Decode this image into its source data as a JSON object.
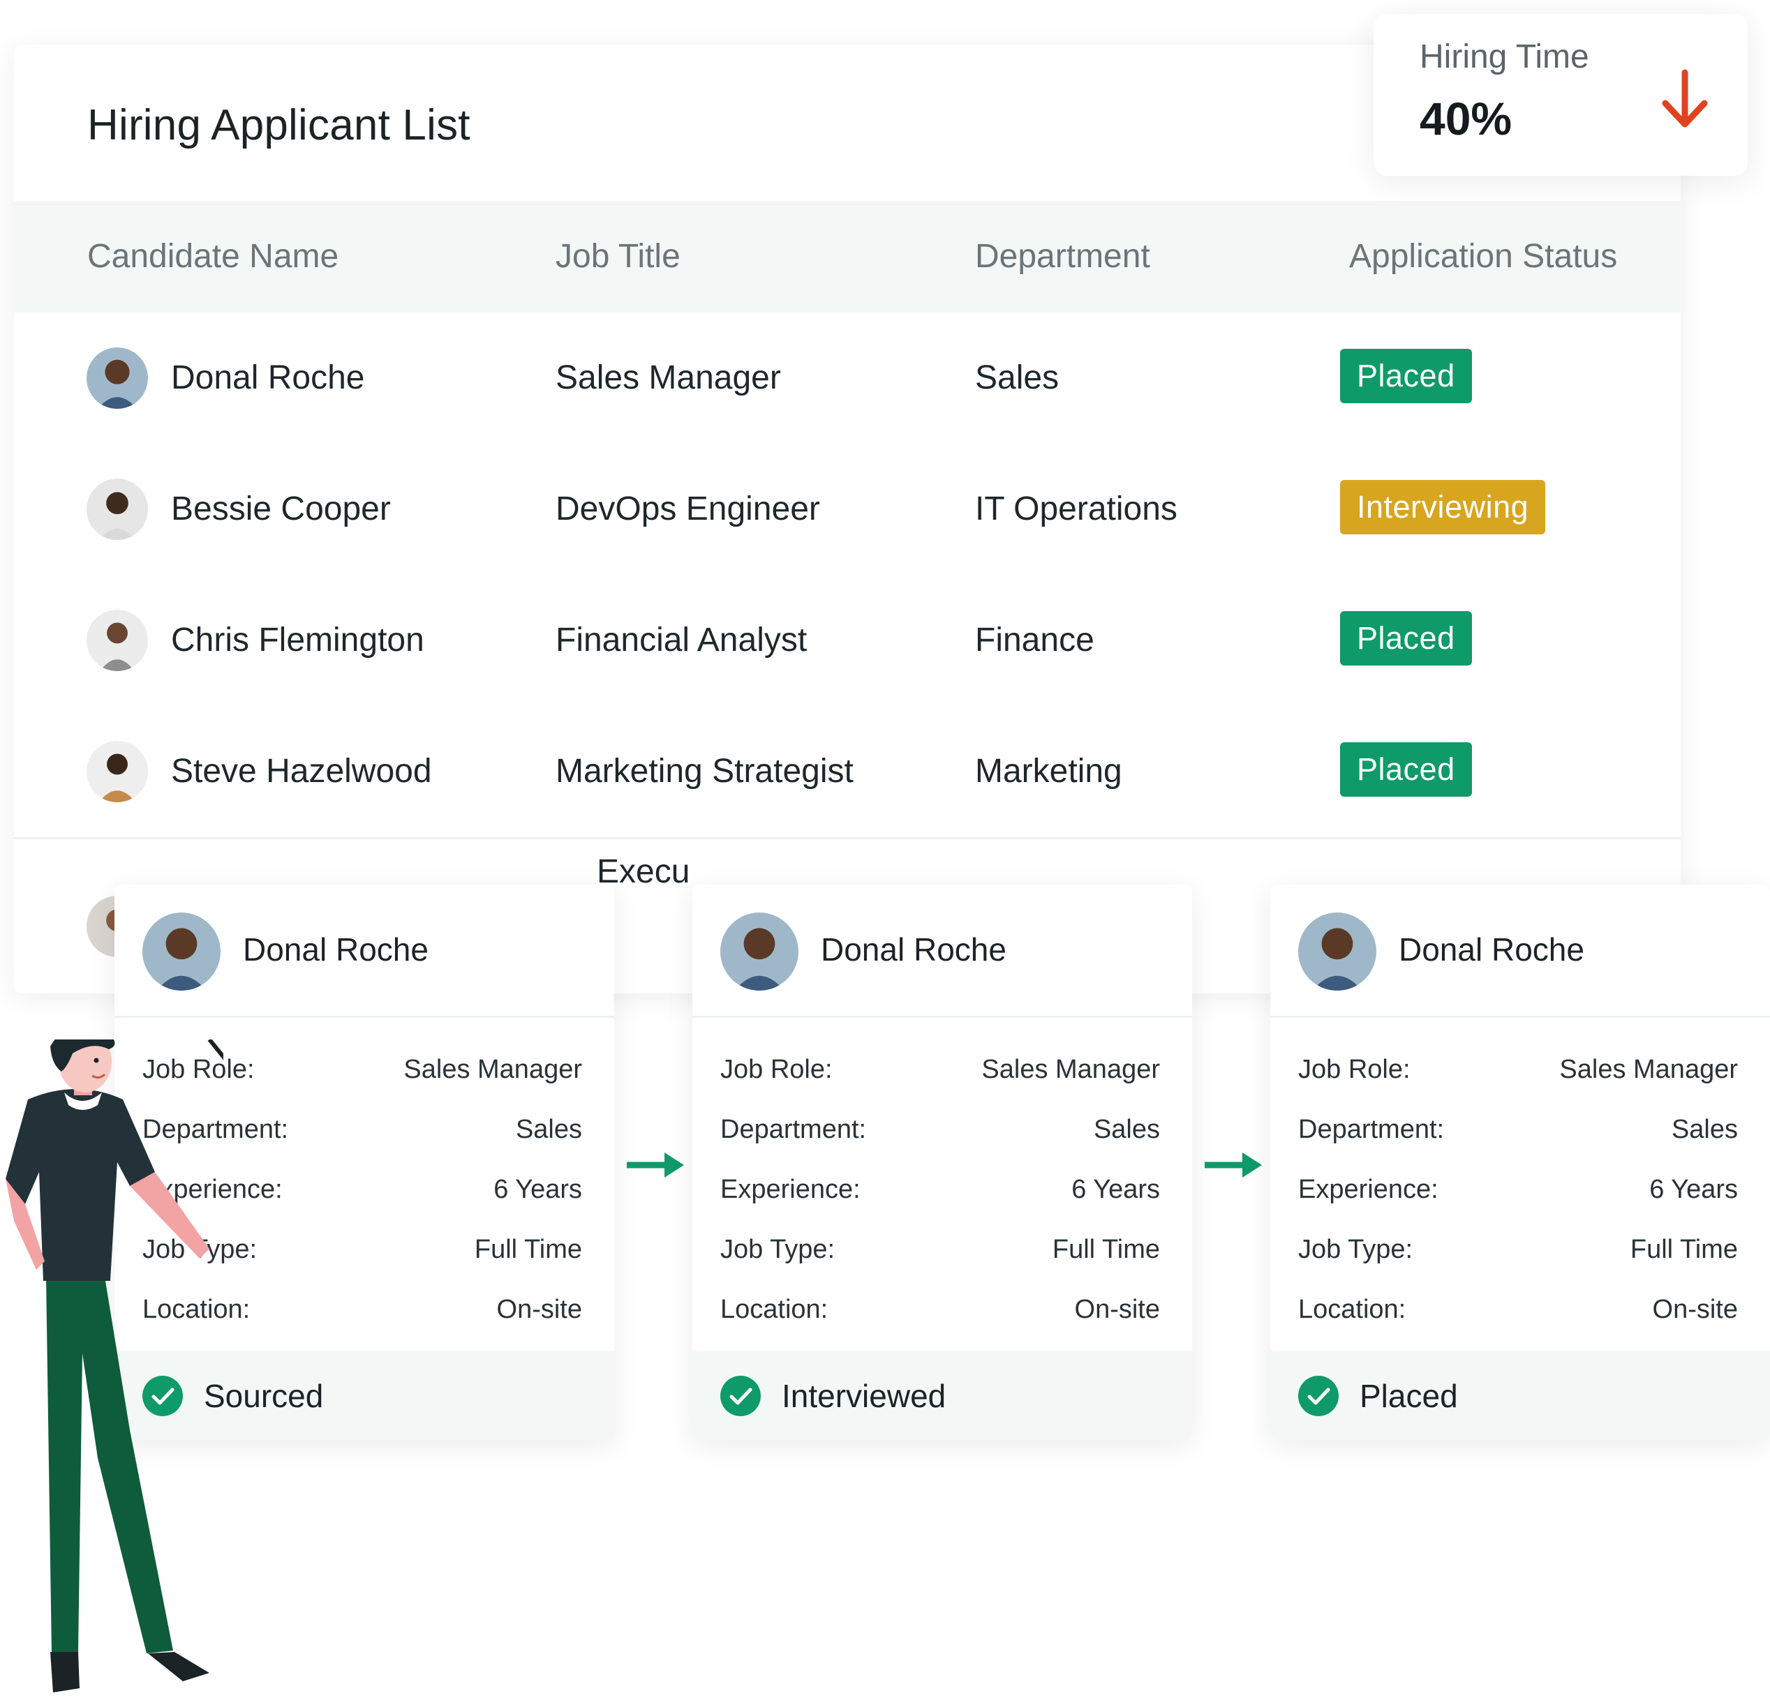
{
  "page": {
    "title": "Hiring Applicant List"
  },
  "table": {
    "headers": [
      "Candidate Name",
      "Job Title",
      "Department",
      "Application Status"
    ],
    "rows": [
      {
        "name": "Donal Roche",
        "job": "Sales Manager",
        "dept": "Sales",
        "status": "Placed",
        "status_color": "#0f9a6a"
      },
      {
        "name": "Bessie Cooper",
        "job": "DevOps Engineer",
        "dept": "IT Operations",
        "status": "Interviewing",
        "status_color": "#d8a51e"
      },
      {
        "name": "Chris Flemington",
        "job": "Financial Analyst",
        "dept": "Finance",
        "status": "Placed",
        "status_color": "#0f9a6a"
      },
      {
        "name": "Steve Hazelwood",
        "job": "Marketing Strategist",
        "dept": "Marketing",
        "status": "Placed",
        "status_color": "#0f9a6a"
      }
    ],
    "partial_row_text": "Execu"
  },
  "kpi": {
    "label": "Hiring Time",
    "value": "40%",
    "trend_icon": "arrow-down-icon",
    "trend_color": "#e0431f"
  },
  "cards": [
    {
      "name": "Donal Roche",
      "fields": [
        {
          "key": "Job Role:",
          "value": "Sales Manager"
        },
        {
          "key": "Department:",
          "value": "Sales"
        },
        {
          "key": "Experience:",
          "value": "6 Years"
        },
        {
          "key": "Job Type:",
          "value": "Full Time"
        },
        {
          "key": "Location:",
          "value": "On-site"
        }
      ],
      "stage": "Sourced"
    },
    {
      "name": "Donal Roche",
      "fields": [
        {
          "key": "Job Role:",
          "value": "Sales Manager"
        },
        {
          "key": "Department:",
          "value": "Sales"
        },
        {
          "key": "Experience:",
          "value": "6 Years"
        },
        {
          "key": "Job Type:",
          "value": "Full Time"
        },
        {
          "key": "Location:",
          "value": "On-site"
        }
      ],
      "stage": "Interviewed"
    },
    {
      "name": "Donal Roche",
      "fields": [
        {
          "key": "Job Role:",
          "value": "Sales Manager"
        },
        {
          "key": "Department:",
          "value": "Sales"
        },
        {
          "key": "Experience:",
          "value": "6 Years"
        },
        {
          "key": "Job Type:",
          "value": "Full Time"
        },
        {
          "key": "Location:",
          "value": "On-site"
        }
      ],
      "stage": "Placed"
    }
  ],
  "colors": {
    "accent": "#0f9a6a",
    "header_bg": "#f3f8f6"
  }
}
